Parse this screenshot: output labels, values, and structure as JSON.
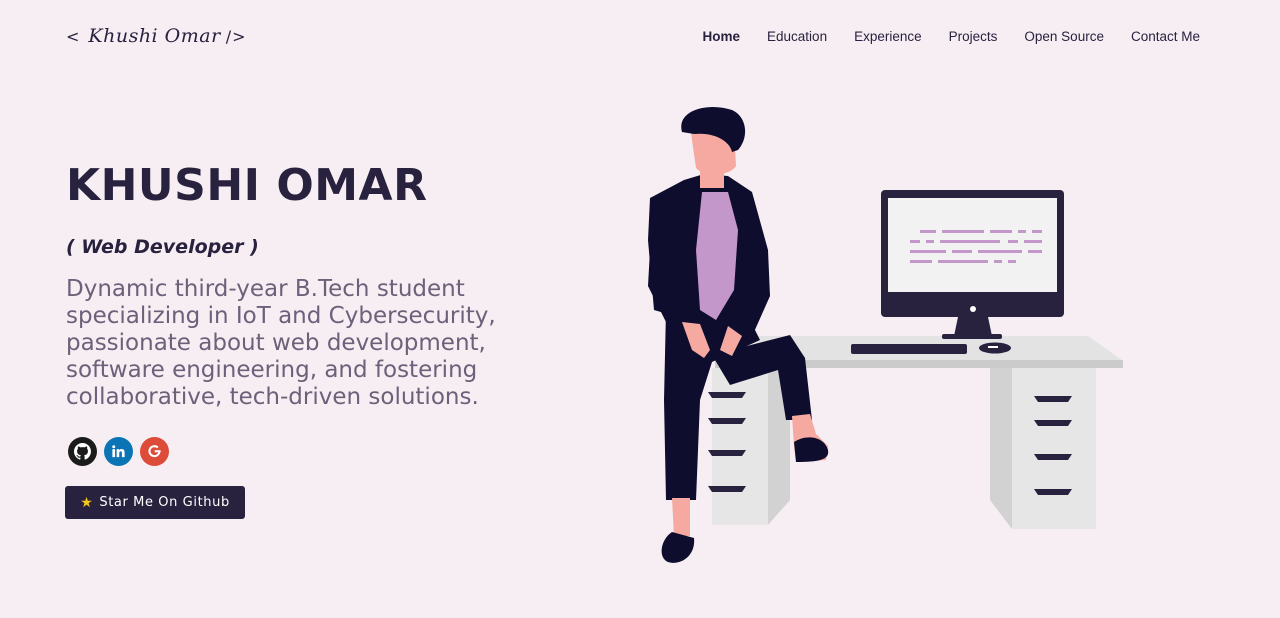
{
  "header": {
    "logo": {
      "open_bracket": "<",
      "signature": "Khushi Omar",
      "close_bracket": "/>"
    },
    "nav": [
      {
        "label": "Home",
        "active": true
      },
      {
        "label": "Education",
        "active": false
      },
      {
        "label": "Experience",
        "active": false
      },
      {
        "label": "Projects",
        "active": false
      },
      {
        "label": "Open Source",
        "active": false
      },
      {
        "label": "Contact Me",
        "active": false
      }
    ]
  },
  "hero": {
    "name": "KHUSHI OMAR",
    "role": "( Web Developer )",
    "bio": "Dynamic third-year B.Tech student specializing in IoT and Cybersecurity, passionate about web development, software engineering, and fostering collaborative, tech-driven solutions.",
    "socials": [
      {
        "icon": "github-icon",
        "color": "#1b1b1b"
      },
      {
        "icon": "linkedin-icon",
        "color": "#0a74b5"
      },
      {
        "icon": "google-icon",
        "color": "#dd4b39"
      }
    ],
    "cta": {
      "icon": "star-icon",
      "label": "Star Me On Github"
    }
  },
  "colors": {
    "background": "#f7eef3",
    "primary": "#29223f",
    "text_muted": "#6b617a",
    "accent_purple": "#c397c9"
  }
}
